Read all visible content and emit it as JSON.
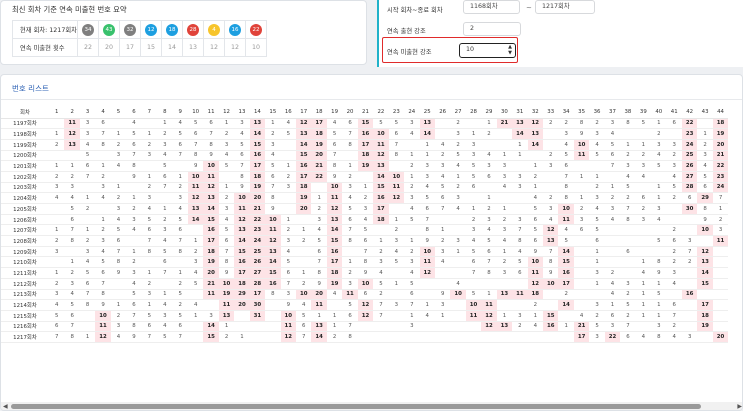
{
  "summary": {
    "title": "최신 회차 기준 연속 미출현 번호 요약",
    "row1_label": "현재 회차: 1217회차",
    "row2_label": "연속 미출현 횟수",
    "balls": [
      {
        "n": "34",
        "c": "#7f7f7f"
      },
      {
        "n": "43",
        "c": "#39c16d"
      },
      {
        "n": "32",
        "c": "#7f7f7f"
      },
      {
        "n": "12",
        "c": "#1d9fe0"
      },
      {
        "n": "18",
        "c": "#1d9fe0"
      },
      {
        "n": "28",
        "c": "#e0433a"
      },
      {
        "n": "4",
        "c": "#f7c52c"
      },
      {
        "n": "16",
        "c": "#1d9fe0"
      },
      {
        "n": "22",
        "c": "#e0433a"
      }
    ],
    "counts": [
      "22",
      "20",
      "17",
      "15",
      "14",
      "13",
      "12",
      "12",
      "10"
    ]
  },
  "filters": {
    "range_label": "시작 회차~종료 회차",
    "start": "1168회차",
    "end": "1217회차",
    "dash": "~",
    "streak_label": "연속 출현 강조",
    "streak_value": "2",
    "absence_label": "연속 미출현 강조",
    "absence_value": "10"
  },
  "list": {
    "title": "번호 리스트",
    "header": [
      "회차",
      "1",
      "2",
      "3",
      "4",
      "5",
      "6",
      "7",
      "8",
      "9",
      "10",
      "11",
      "12",
      "13",
      "14",
      "15",
      "16",
      "17",
      "18",
      "19",
      "20",
      "21",
      "22",
      "23",
      "24",
      "25",
      "26",
      "27",
      "28",
      "29",
      "30",
      "31",
      "32",
      "33",
      "34",
      "35",
      "36",
      "37",
      "38",
      "39",
      "40",
      "41",
      "42",
      "43",
      "44"
    ],
    "rows": [
      [
        "1197회차",
        "",
        "11",
        "3",
        "6",
        "",
        "4",
        "",
        "1",
        "4",
        "5",
        "6",
        "1",
        "3",
        "13",
        "1",
        "4",
        "12",
        "17",
        "4",
        "6",
        "15",
        "5",
        "5",
        "3",
        "13",
        "",
        "2",
        "",
        "1",
        "21",
        "13",
        "12",
        "2",
        "2",
        "8",
        "2",
        "3",
        "8",
        "5",
        "1",
        "6",
        "22",
        "",
        "18"
      ],
      [
        "1198회차",
        "1",
        "12",
        "3",
        "7",
        "1",
        "5",
        "1",
        "2",
        "5",
        "6",
        "7",
        "2",
        "4",
        "14",
        "2",
        "5",
        "13",
        "18",
        "5",
        "7",
        "16",
        "10",
        "6",
        "4",
        "14",
        "",
        "3",
        "1",
        "2",
        "",
        "14",
        "13",
        "",
        "3",
        "9",
        "3",
        "4",
        "",
        "",
        "2",
        "",
        "23",
        "1",
        "19"
      ],
      [
        "1199회차",
        "2",
        "13",
        "4",
        "8",
        "2",
        "6",
        "2",
        "3",
        "6",
        "7",
        "8",
        "3",
        "5",
        "15",
        "3",
        "",
        "14",
        "19",
        "6",
        "8",
        "17",
        "11",
        "7",
        "",
        "1",
        "4",
        "2",
        "3",
        "",
        "",
        "1",
        "14",
        "",
        "4",
        "10",
        "4",
        "5",
        "1",
        "1",
        "3",
        "3",
        "24",
        "2",
        "20"
      ],
      [
        "1200회차",
        "",
        "",
        "5",
        "",
        "3",
        "7",
        "3",
        "4",
        "7",
        "8",
        "9",
        "4",
        "6",
        "16",
        "4",
        "",
        "15",
        "20",
        "7",
        "",
        "18",
        "12",
        "8",
        "1",
        "1",
        "2",
        "5",
        "3",
        "4",
        "1",
        "1",
        "",
        "2",
        "5",
        "11",
        "5",
        "6",
        "2",
        "2",
        "4",
        "2",
        "25",
        "3",
        "21"
      ],
      [
        "1201회차",
        "1",
        "1",
        "6",
        "1",
        "4",
        "8",
        "",
        "5",
        "",
        "9",
        "10",
        "5",
        "7",
        "17",
        "5",
        "1",
        "16",
        "21",
        "8",
        "1",
        "19",
        "13",
        "",
        "2",
        "3",
        "3",
        "4",
        "5",
        "3",
        "3",
        "",
        "1",
        "3",
        "6",
        "",
        "",
        "7",
        "3",
        "3",
        "5",
        "3",
        "26",
        "4",
        "22"
      ],
      [
        "1202회차",
        "2",
        "2",
        "7",
        "2",
        "",
        "9",
        "1",
        "6",
        "1",
        "10",
        "11",
        "",
        "8",
        "18",
        "6",
        "2",
        "17",
        "22",
        "9",
        "2",
        "",
        "14",
        "10",
        "1",
        "3",
        "4",
        "1",
        "5",
        "6",
        "3",
        "3",
        "2",
        "",
        "7",
        "1",
        "1",
        "",
        "4",
        "4",
        "",
        "4",
        "27",
        "5",
        "23"
      ],
      [
        "1203회차",
        "3",
        "3",
        "",
        "3",
        "1",
        "",
        "2",
        "7",
        "2",
        "11",
        "12",
        "1",
        "9",
        "19",
        "7",
        "3",
        "18",
        "",
        "10",
        "3",
        "1",
        "15",
        "11",
        "2",
        "4",
        "5",
        "2",
        "6",
        "",
        "4",
        "3",
        "1",
        "",
        "8",
        "",
        "2",
        "1",
        "5",
        "",
        "1",
        "5",
        "28",
        "6",
        "24"
      ],
      [
        "1204회차",
        "4",
        "4",
        "1",
        "4",
        "2",
        "1",
        "3",
        "",
        "3",
        "12",
        "13",
        "2",
        "10",
        "20",
        "8",
        "",
        "19",
        "1",
        "11",
        "4",
        "2",
        "16",
        "12",
        "3",
        "5",
        "6",
        "3",
        "",
        "1",
        "",
        "",
        "4",
        "2",
        "8",
        "1",
        "3",
        "2",
        "2",
        "6",
        "1",
        "2",
        "6",
        "29",
        "7"
      ],
      [
        "1205회차",
        "",
        "5",
        "2",
        "",
        "3",
        "2",
        "4",
        "1",
        "4",
        "13",
        "14",
        "3",
        "11",
        "21",
        "9",
        "",
        "20",
        "2",
        "12",
        "5",
        "3",
        "17",
        "",
        "4",
        "6",
        "7",
        "4",
        "1",
        "2",
        "1",
        "",
        "5",
        "3",
        "10",
        "2",
        "4",
        "3",
        "7",
        "2",
        "3",
        "",
        "30",
        "8",
        "1"
      ],
      [
        "1206회차",
        "",
        "6",
        "",
        "1",
        "4",
        "3",
        "5",
        "2",
        "5",
        "14",
        "15",
        "4",
        "12",
        "22",
        "10",
        "1",
        "",
        "3",
        "13",
        "6",
        "4",
        "18",
        "1",
        "5",
        "7",
        "",
        "",
        "2",
        "3",
        "2",
        "3",
        "6",
        "4",
        "11",
        "3",
        "5",
        "4",
        "8",
        "3",
        "4",
        "",
        "",
        "9",
        "2"
      ],
      [
        "1207회차",
        "1",
        "7",
        "1",
        "2",
        "5",
        "4",
        "6",
        "3",
        "6",
        "",
        "16",
        "5",
        "13",
        "23",
        "11",
        "2",
        "1",
        "4",
        "14",
        "7",
        "5",
        "",
        "2",
        "",
        "8",
        "1",
        "",
        "3",
        "4",
        "3",
        "7",
        "5",
        "12",
        "4",
        "6",
        "5",
        "",
        "",
        "",
        "",
        "2",
        "",
        "10",
        "3"
      ],
      [
        "1208회차",
        "2",
        "8",
        "2",
        "3",
        "6",
        "",
        "7",
        "4",
        "7",
        "1",
        "17",
        "6",
        "14",
        "24",
        "12",
        "3",
        "2",
        "5",
        "15",
        "8",
        "6",
        "1",
        "3",
        "1",
        "9",
        "2",
        "3",
        "4",
        "5",
        "4",
        "8",
        "6",
        "13",
        "5",
        "",
        "6",
        "",
        "",
        "",
        "5",
        "6",
        "3",
        "",
        "11"
      ],
      [
        "1209회차",
        "3",
        "",
        "3",
        "4",
        "7",
        "1",
        "8",
        "5",
        "8",
        "2",
        "18",
        "7",
        "15",
        "25",
        "13",
        "4",
        "",
        "6",
        "16",
        "",
        "7",
        "2",
        "4",
        "2",
        "10",
        "3",
        "1",
        "5",
        "6",
        "1",
        "4",
        "9",
        "7",
        "14",
        "",
        "1",
        "",
        "6",
        "",
        "",
        "2",
        "7",
        "12",
        ""
      ],
      [
        "1210회차",
        "",
        "1",
        "4",
        "5",
        "8",
        "2",
        "",
        "6",
        "",
        "3",
        "19",
        "8",
        "16",
        "26",
        "14",
        "5",
        "",
        "7",
        "17",
        "1",
        "8",
        "3",
        "5",
        "3",
        "11",
        "4",
        "",
        "6",
        "7",
        "2",
        "5",
        "10",
        "8",
        "15",
        "",
        "1",
        "",
        "",
        "1",
        "8",
        "2",
        "2",
        "13",
        ""
      ],
      [
        "1211회차",
        "1",
        "2",
        "5",
        "6",
        "9",
        "3",
        "1",
        "7",
        "1",
        "4",
        "20",
        "9",
        "17",
        "27",
        "15",
        "6",
        "1",
        "8",
        "18",
        "2",
        "9",
        "4",
        "",
        "4",
        "12",
        "",
        "",
        "7",
        "8",
        "3",
        "6",
        "11",
        "9",
        "16",
        "",
        "3",
        "2",
        "",
        "4",
        "9",
        "3",
        "",
        "14",
        ""
      ],
      [
        "1212회차",
        "2",
        "3",
        "6",
        "7",
        "",
        "4",
        "2",
        "",
        "2",
        "5",
        "21",
        "10",
        "18",
        "28",
        "16",
        "7",
        "2",
        "9",
        "19",
        "3",
        "10",
        "5",
        "1",
        "5",
        "",
        "",
        "4",
        "",
        "",
        "",
        "",
        "12",
        "10",
        "17",
        "",
        "1",
        "4",
        "3",
        "1",
        "1",
        "4",
        "",
        "15",
        ""
      ],
      [
        "1213회차",
        "3",
        "4",
        "7",
        "8",
        "",
        "5",
        "3",
        "1",
        "5",
        "",
        "11",
        "19",
        "29",
        "17",
        "8",
        "3",
        "10",
        "20",
        "4",
        "11",
        "6",
        "2",
        "",
        "6",
        "",
        "9",
        "10",
        "5",
        "1",
        "13",
        "11",
        "18",
        "",
        "2",
        "",
        "",
        "4",
        "2",
        "1",
        "5",
        "",
        "16",
        "",
        ""
      ],
      [
        "1214회차",
        "4",
        "5",
        "8",
        "9",
        "1",
        "6",
        "1",
        "4",
        "2",
        "4",
        "",
        "11",
        "20",
        "30",
        "",
        "9",
        "4",
        "11",
        "",
        "5",
        "12",
        "7",
        "3",
        "7",
        "1",
        "3",
        "",
        "10",
        "11",
        "",
        "",
        "2",
        "",
        "14",
        "",
        "3",
        "1",
        "5",
        "1",
        "1",
        "6",
        "",
        "17",
        ""
      ],
      [
        "1215회차",
        "5",
        "6",
        "",
        "10",
        "2",
        "7",
        "5",
        "3",
        "5",
        "1",
        "3",
        "13",
        "",
        "31",
        "",
        "10",
        "5",
        "1",
        "1",
        "6",
        "12",
        "7",
        "",
        "1",
        "4",
        "1",
        "",
        "11",
        "12",
        "1",
        "3",
        "1",
        "15",
        "",
        "4",
        "2",
        "6",
        "2",
        "1",
        "1",
        "7",
        "",
        "18",
        ""
      ],
      [
        "1216회차",
        "6",
        "7",
        "",
        "11",
        "3",
        "8",
        "6",
        "4",
        "6",
        "",
        "14",
        "1",
        "",
        "",
        "",
        "11",
        "6",
        "13",
        "1",
        "7",
        "",
        "",
        "",
        "3",
        "",
        "",
        "",
        "",
        "12",
        "13",
        "2",
        "4",
        "16",
        "1",
        "21",
        "5",
        "3",
        "7",
        "",
        "3",
        "2",
        "",
        "19",
        ""
      ],
      [
        "1217회차",
        "7",
        "8",
        "1",
        "12",
        "4",
        "9",
        "7",
        "5",
        "7",
        "",
        "15",
        "2",
        "1",
        "",
        "",
        "12",
        "7",
        "14",
        "2",
        "8",
        "",
        "",
        "",
        "",
        "",
        "",
        "",
        "",
        "",
        "",
        "",
        "",
        "",
        "",
        "17",
        "3",
        "22",
        "6",
        "4",
        "8",
        "4",
        "3",
        "",
        "20"
      ]
    ],
    "highlight_min": 10
  }
}
